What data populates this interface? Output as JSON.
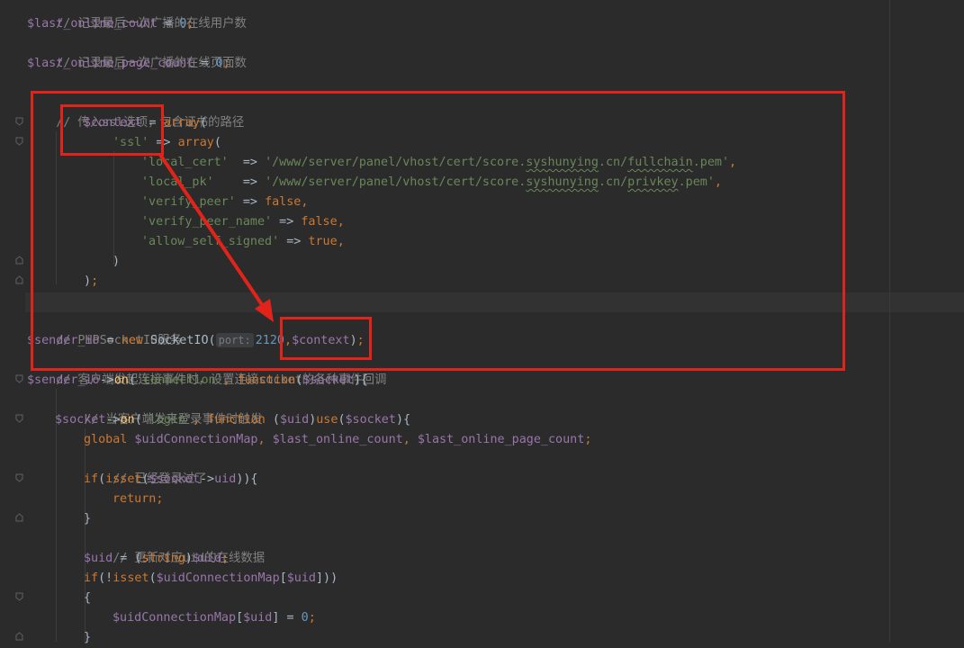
{
  "editor": {
    "colors": {
      "background": "#2b2b2b",
      "comment": "#808080",
      "variable": "#9876aa",
      "number": "#6897bb",
      "string": "#6a8759",
      "keyword": "#cc7832",
      "function": "#ffc66d",
      "plain": "#a9b7c6",
      "annotation": "#e2231a"
    },
    "lines": {
      "l1": {
        "c1": "// 记录最后一次广播的在线用户数"
      },
      "l2": {
        "v1": "$last_online_count",
        "p1": " = ",
        "n1": "0",
        "k1": ";"
      },
      "l3": {
        "c1": "// 记录最后一次广播的在线页面数"
      },
      "l4": {
        "v1": "$last_online_page_count",
        "p1": " = ",
        "n1": "0",
        "k1": ";"
      },
      "l6": {
        "c1": "// 传入ssl选项，包含证书的路径"
      },
      "l7": {
        "v1": "$context",
        "p1": " = ",
        "k1": "array",
        "p2": "("
      },
      "l8": {
        "s1": "'ssl'",
        "p1": " => ",
        "k1": "array",
        "p2": "("
      },
      "l9": {
        "s1": "'local_cert'",
        "p1": "  => ",
        "s2": "'/www/server/panel/vhost/cert/score.",
        "s3": "syshunying",
        "s4": ".cn/",
        "s5": "fullchain",
        "s6": ".pem'",
        "k1": ","
      },
      "l10": {
        "s1": "'local_pk'",
        "p1": "    => ",
        "s2": "'/www/server/panel/vhost/cert/score.",
        "s3": "syshunying",
        "s4": ".cn/",
        "s5": "privkey",
        "s6": ".pem'",
        "k1": ","
      },
      "l11": {
        "s1": "'verify_peer'",
        "p1": " => ",
        "k1": "false",
        "k2": ","
      },
      "l12": {
        "s1": "'verify_peer_name'",
        "p1": " => ",
        "k1": "false",
        "k2": ","
      },
      "l13": {
        "s1": "'allow_self_signed'",
        "p1": " => ",
        "k1": "true",
        "k2": ","
      },
      "l14": {
        "p1": ")"
      },
      "l15": {
        "p1": ")",
        "k1": ";"
      },
      "l17": {
        "c1": "// PHPSocketIO服务"
      },
      "l18": {
        "v1": "$sender_io",
        "p1": " = ",
        "k1": "new",
        "p2": " SocketIO(",
        "hint": "port:",
        "n1": "2120",
        "k2": ",",
        "v2": "$context",
        "p3": ")",
        "k3": ";"
      },
      "l19": {
        "c1": "// 客户端发起连接事件时，设置连接socket的各种事件回调"
      },
      "l20": {
        "v1": "$sender_io",
        "p1": "->",
        "f1": "on",
        "p2": "(",
        "s1": "'connection'",
        "k1": ", ",
        "k2": "function",
        "p3": "(",
        "v2": "$socket",
        "p4": "){"
      },
      "l21": {
        "c1": "// 当客户端发来登录事件时触发"
      },
      "l22": {
        "v1": "$socket",
        "p1": "->",
        "f1": "on",
        "p2": "(",
        "s1": "'login'",
        "k1": ", ",
        "k2": "function",
        "p3": " (",
        "v2": "$uid",
        "p4": ")",
        "k3": "use",
        "p5": "(",
        "v3": "$socket",
        "p6": "){"
      },
      "l23": {
        "k1": "global",
        "v1": " $uidConnectionMap",
        "k2": ", ",
        "v2": "$last_online_count",
        "k3": ", ",
        "v3": "$last_online_page_count",
        "k4": ";"
      },
      "l24": {
        "c1": "// 已经登录过了"
      },
      "l25": {
        "k1": "if",
        "p1": "(",
        "k2": "isset",
        "p2": "(",
        "v1": "$socket",
        "p3": "->",
        "v2": "uid",
        "p4": ")){"
      },
      "l26": {
        "k1": "return",
        "k2": ";"
      },
      "l27": {
        "p1": "}"
      },
      "l28": {
        "c1": "// 更新对应uid的在线数据"
      },
      "l29": {
        "v1": "$uid",
        "p1": " = (",
        "k1": "string",
        "p2": ")",
        "v2": "$uid",
        "k2": ";"
      },
      "l30": {
        "k1": "if",
        "p1": "(!",
        "k2": "isset",
        "p2": "(",
        "v1": "$uidConnectionMap",
        "p3": "[",
        "v2": "$uid",
        "p4": "]))"
      },
      "l31": {
        "p1": "{"
      },
      "l32": {
        "v1": "$uidConnectionMap",
        "p1": "[",
        "v2": "$uid",
        "p2": "] = ",
        "n1": "0",
        "k1": ";"
      },
      "l33": {
        "p1": "}"
      }
    }
  }
}
